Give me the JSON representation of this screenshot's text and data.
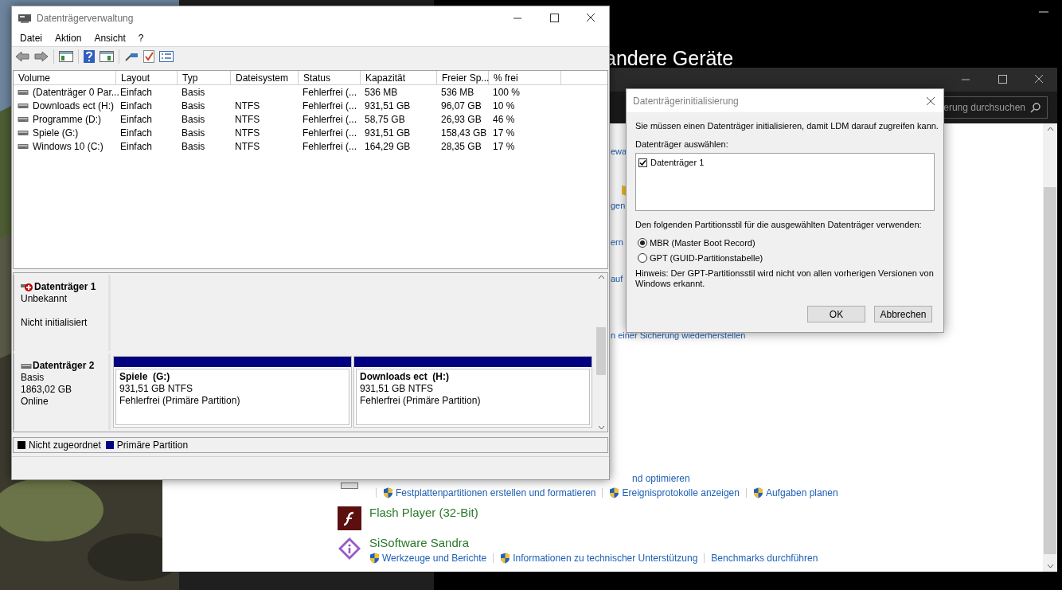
{
  "settings_window": {
    "heading": "andere Geräte"
  },
  "control_panel": {
    "search": {
      "value": "erung durchsuchen"
    },
    "fragments": [
      "ewa",
      "gen",
      "ern",
      "auf",
      "n einer Sicherung wiederherstellen"
    ],
    "programs": [
      {
        "kind": "disk",
        "links": [
          {
            "text": "nd optimieren",
            "shield": false
          },
          {
            "text": "Festplattenpartitionen erstellen und formatieren",
            "shield": true
          },
          {
            "text": "Ereignisprotokolle anzeigen",
            "shield": true
          },
          {
            "text": "Aufgaben planen",
            "shield": true
          }
        ]
      },
      {
        "kind": "flash",
        "name": "Flash Player (32-Bit)"
      },
      {
        "kind": "sandra",
        "name": "SiSoftware Sandra",
        "links": [
          {
            "text": "Werkzeuge und Berichte",
            "shield": true
          },
          {
            "text": "Informationen zu technischer Unterstützung",
            "shield": true
          },
          {
            "text": "Benchmarks durchführen",
            "shield": false
          }
        ]
      }
    ]
  },
  "disk_management": {
    "title": "Datenträgerverwaltung",
    "menu": [
      "Datei",
      "Aktion",
      "Ansicht",
      "?"
    ],
    "table": {
      "columns": [
        "Volume",
        "Layout",
        "Typ",
        "Dateisystem",
        "Status",
        "Kapazität",
        "Freier Sp...",
        "% frei"
      ],
      "rows": [
        [
          "(Datenträger 0 Par...",
          "Einfach",
          "Basis",
          "",
          "Fehlerfrei (...",
          "536 MB",
          "536 MB",
          "100 %"
        ],
        [
          "Downloads ect (H:)",
          "Einfach",
          "Basis",
          "NTFS",
          "Fehlerfrei (...",
          "931,51 GB",
          "96,07 GB",
          "10 %"
        ],
        [
          "Programme (D:)",
          "Einfach",
          "Basis",
          "NTFS",
          "Fehlerfrei (...",
          "58,75 GB",
          "26,93 GB",
          "46 %"
        ],
        [
          "Spiele (G:)",
          "Einfach",
          "Basis",
          "NTFS",
          "Fehlerfrei (...",
          "931,51 GB",
          "158,43 GB",
          "17 %"
        ],
        [
          "Windows 10 (C:)",
          "Einfach",
          "Basis",
          "NTFS",
          "Fehlerfrei (...",
          "164,29 GB",
          "28,35 GB",
          "17 %"
        ]
      ]
    },
    "disks": [
      {
        "name": "Datenträger 1",
        "kind": "error",
        "lines": [
          "Unbekannt",
          "Nicht initialisiert"
        ]
      },
      {
        "name": "Datenträger 2",
        "kind": "ok",
        "lines": [
          "Basis",
          "1863,02 GB",
          "Online"
        ],
        "partitions": [
          {
            "name": "Spiele  (G:)",
            "size": "931,51 GB NTFS",
            "state": "Fehlerfrei (Primäre Partition)",
            "color": "#000080"
          },
          {
            "name": "Downloads ect  (H:)",
            "size": "931,51 GB NTFS",
            "state": "Fehlerfrei (Primäre Partition)",
            "color": "#000080"
          }
        ]
      }
    ],
    "legend": [
      {
        "label": "Nicht zugeordnet",
        "color": "#000000"
      },
      {
        "label": "Primäre Partition",
        "color": "#000080"
      }
    ]
  },
  "dialog": {
    "title": "Datenträgerinitialisierung",
    "message": "Sie müssen einen Datenträger initialisieren, damit LDM darauf zugreifen kann.",
    "select_label": "Datenträger auswählen:",
    "disks": [
      {
        "label": "Datenträger 1",
        "checked": true
      }
    ],
    "style_label": "Den folgenden Partitionsstil für die ausgewählten Datenträger verwenden:",
    "options": [
      {
        "label": "MBR (Master Boot Record)",
        "selected": true
      },
      {
        "label": "GPT (GUID-Partitionstabelle)",
        "selected": false
      }
    ],
    "note": "Hinweis: Der GPT-Partitionsstil wird nicht von allen vorherigen Versionen von Windows erkannt.",
    "buttons": [
      "OK",
      "Abbrechen"
    ]
  }
}
